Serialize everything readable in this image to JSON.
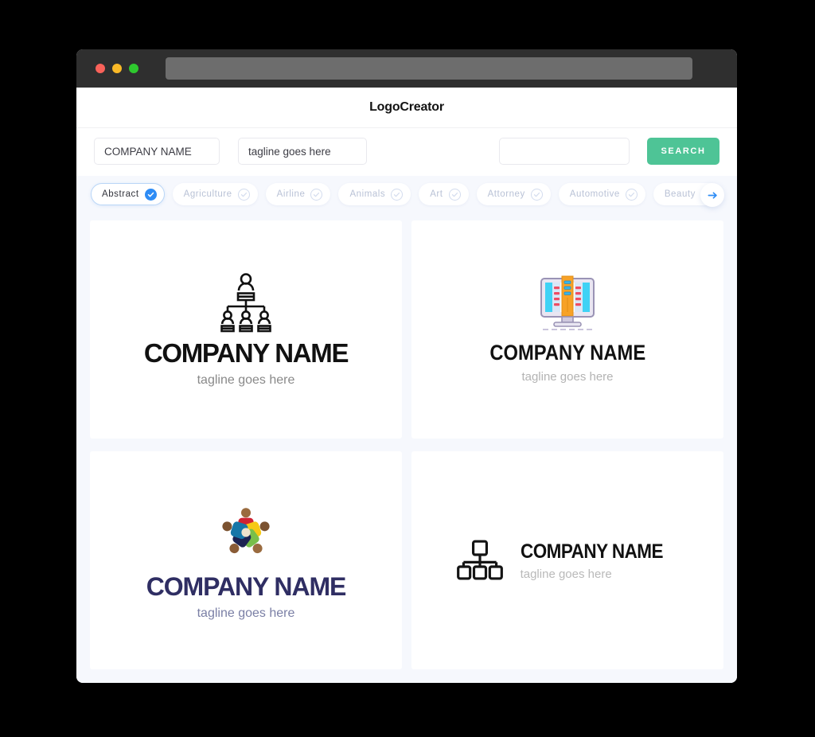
{
  "window": {
    "traffic_lights": [
      "close-red",
      "minimize-yellow",
      "maximize-green"
    ],
    "address_bar_value": ""
  },
  "header": {
    "title": "LogoCreator"
  },
  "form": {
    "company_value": "COMPANY NAME",
    "company_placeholder": "COMPANY NAME",
    "tagline_value": "tagline goes here",
    "tagline_placeholder": "tagline goes here",
    "keyword_value": "",
    "keyword_placeholder": "",
    "search_label": "SEARCH"
  },
  "categories": {
    "next_icon": "arrow-right-icon",
    "items": [
      {
        "label": "Abstract",
        "selected": true
      },
      {
        "label": "Agriculture",
        "selected": false
      },
      {
        "label": "Airline",
        "selected": false
      },
      {
        "label": "Animals",
        "selected": false
      },
      {
        "label": "Art",
        "selected": false
      },
      {
        "label": "Attorney",
        "selected": false
      },
      {
        "label": "Automotive",
        "selected": false
      },
      {
        "label": "Beauty",
        "selected": false
      }
    ]
  },
  "results": [
    {
      "icon_name": "org-chart-people-icon",
      "company": "COMPANY NAME",
      "tagline": "tagline goes here",
      "layout": "stacked",
      "company_color": "#111111",
      "tagline_color": "#898989"
    },
    {
      "icon_name": "monitor-buildings-icon",
      "company": "COMPANY NAME",
      "tagline": "tagline goes here",
      "layout": "stacked",
      "company_color": "#111111",
      "tagline_color": "#b3b3b3"
    },
    {
      "icon_name": "teamwork-circle-people-icon",
      "company": "COMPANY NAME",
      "tagline": "tagline goes here",
      "layout": "stacked",
      "company_color": "#2f2e63",
      "tagline_color": "#7a7fa5"
    },
    {
      "icon_name": "hierarchy-squares-icon",
      "company": "COMPANY NAME",
      "tagline": "tagline goes here",
      "layout": "horizontal",
      "company_color": "#111111",
      "tagline_color": "#b9b9b9"
    }
  ],
  "colors": {
    "accent_green": "#4ec496",
    "accent_blue": "#2e8cf5",
    "page_background": "#f6f8fd",
    "titlebar": "#2f2f2f",
    "address_bar": "#6d6d6d"
  }
}
